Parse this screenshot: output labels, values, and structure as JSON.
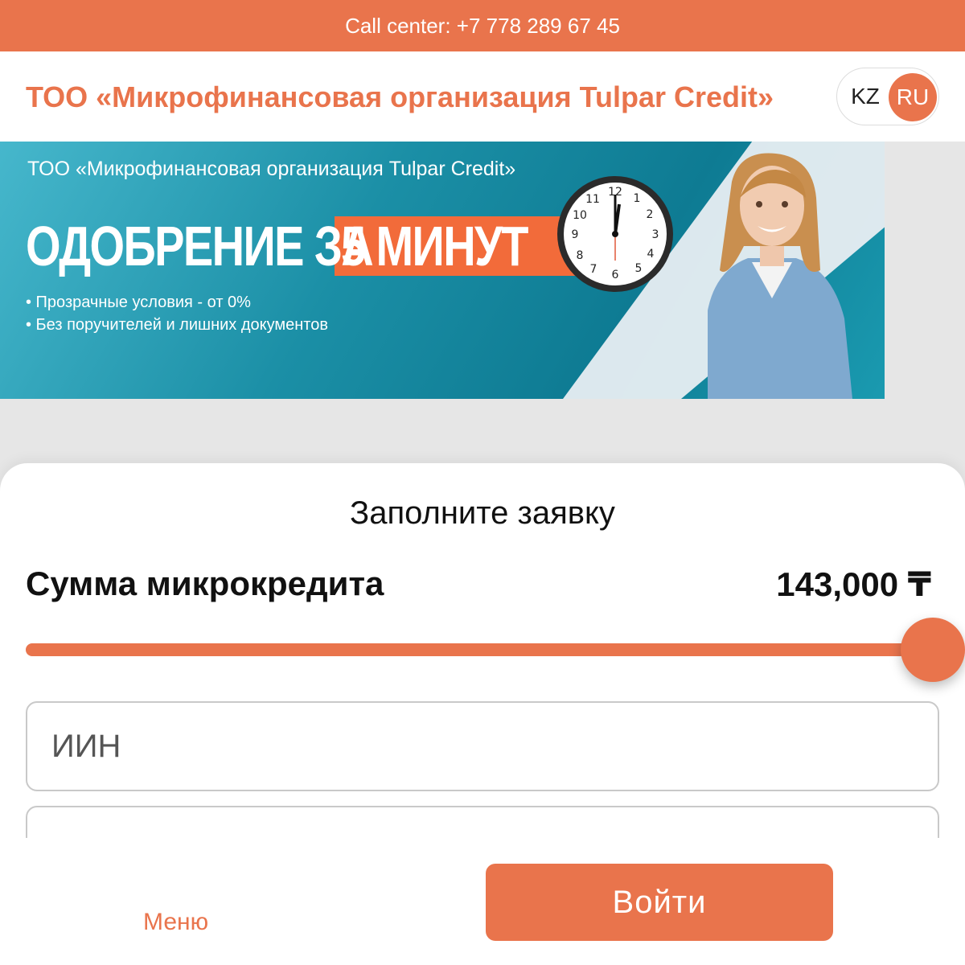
{
  "topbar": {
    "call_center": "Call center: +7 778 289 67 45"
  },
  "header": {
    "title": "ТОО «Микрофинансовая организация Tulpar Credit»",
    "lang": {
      "kz": "KZ",
      "ru": "RU",
      "active": "RU"
    }
  },
  "banner": {
    "subtitle": "ТОО «Микрофинансовая организация Tulpar Credit»",
    "headline_main": "ОДОБРЕНИЕ ЗА",
    "headline_accent": "5 МИНУТ",
    "bullets": [
      "• Прозрачные условия - от 0%",
      "• Без поручителей и лишних документов"
    ]
  },
  "form": {
    "title": "Заполните заявку",
    "amount_label": "Сумма микрокредита",
    "amount_value": "143,000 ₸",
    "slider_fraction": 1.0,
    "iin_placeholder": "ИИН",
    "second_placeholder": ""
  },
  "footer": {
    "menu_label": "Меню",
    "login_label": "Войти"
  },
  "colors": {
    "accent": "#e9744c",
    "banner_teal": "#0e7b93"
  }
}
